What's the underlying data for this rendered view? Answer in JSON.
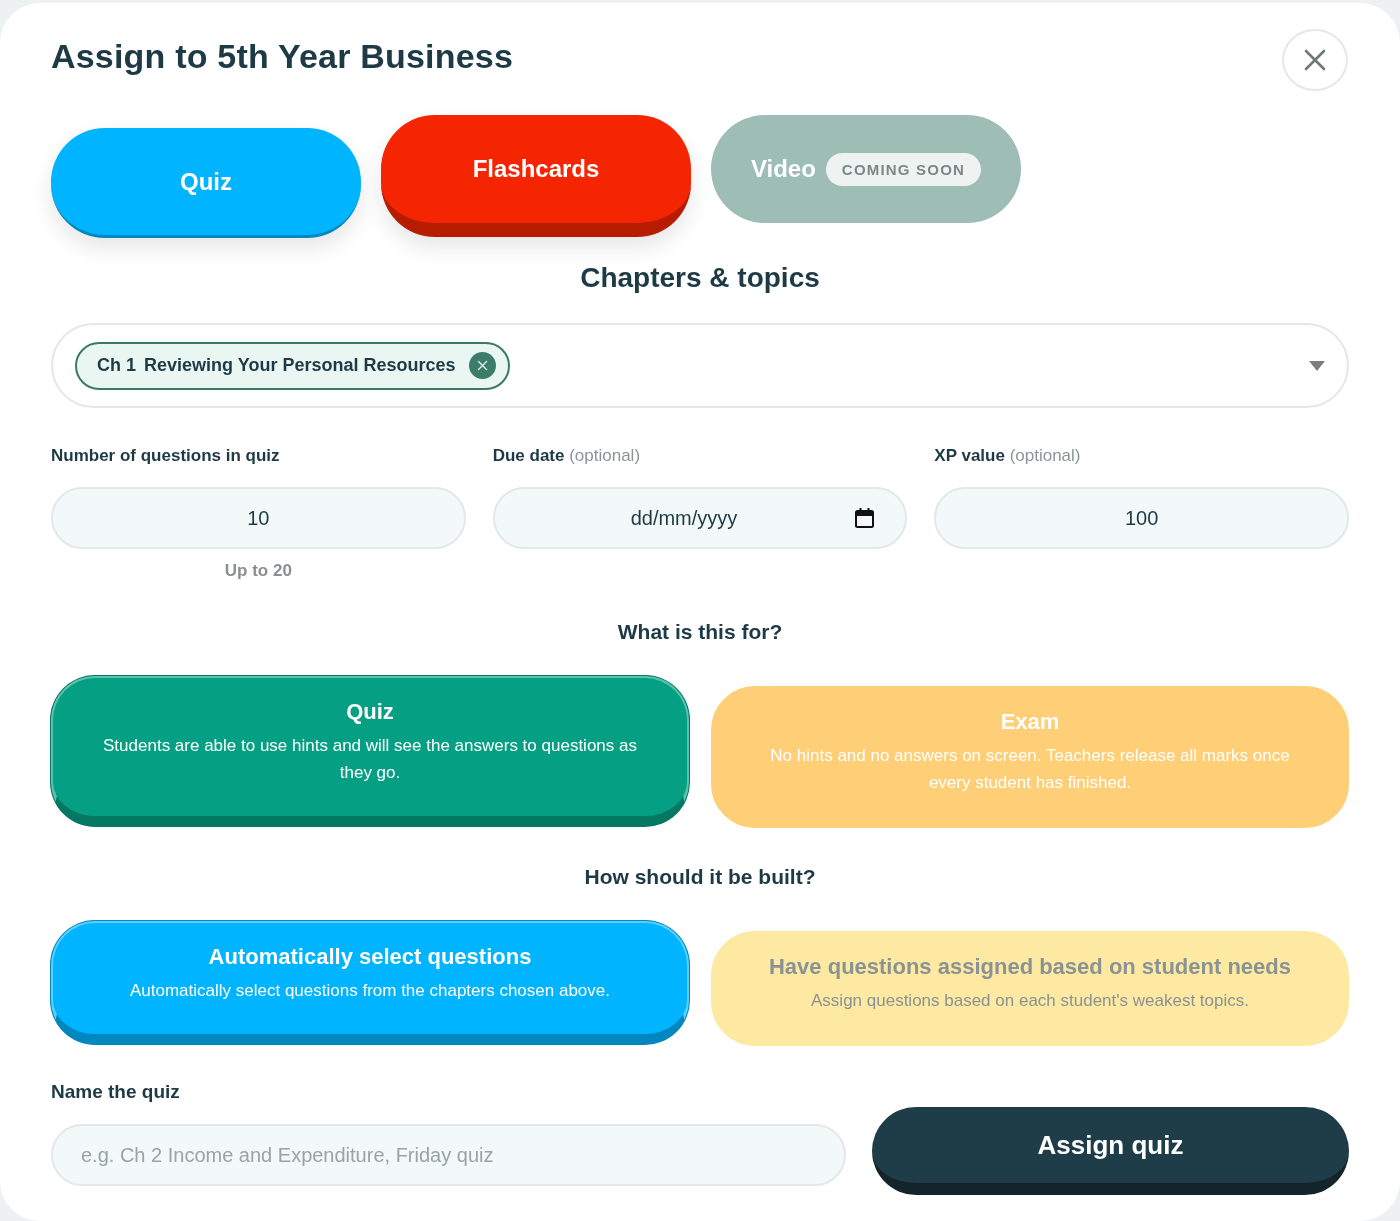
{
  "dialog": {
    "title": "Assign to 5th Year Business"
  },
  "tabs": [
    {
      "label": "Quiz",
      "selected": true,
      "disabled": false,
      "color": "#00b4ff"
    },
    {
      "label": "Flashcards",
      "selected": false,
      "disabled": false,
      "color": "#f42500"
    },
    {
      "label": "Video",
      "badge": "COMING SOON",
      "selected": false,
      "disabled": true,
      "color": "#9ebdb5"
    }
  ],
  "chapters": {
    "heading": "Chapters & topics",
    "chips": [
      {
        "number": "Ch 1",
        "title": "Reviewing Your Personal Resources"
      }
    ]
  },
  "fields": [
    {
      "kind": "number",
      "label": "Number of questions in quiz",
      "value": "10",
      "hint": "Up to 20"
    },
    {
      "kind": "date",
      "label": "Due date",
      "optional": "(optional)",
      "placeholder": "dd/mm/yyyy"
    },
    {
      "kind": "number",
      "label": "XP value",
      "optional": "(optional)",
      "value": "100"
    }
  ],
  "purpose": {
    "heading": "What is this for?",
    "options": [
      {
        "title": "Quiz",
        "description": "Students are able to use hints and will see the answers to questions as they go.",
        "selected": true,
        "disabled": false,
        "color": "#05a083"
      },
      {
        "title": "Exam",
        "description": "No hints and no answers on screen. Teachers release all marks once every student has finished.",
        "selected": false,
        "disabled": false,
        "color": "#fecf77"
      }
    ]
  },
  "build": {
    "heading": "How should it be built?",
    "options": [
      {
        "title": "Automatically select questions",
        "description": "Automatically select questions from the chapters chosen above.",
        "selected": true,
        "disabled": false,
        "color": "#00b4ff"
      },
      {
        "title": "Have questions assigned based on student needs",
        "description": "Assign questions based on each student's weakest topics.",
        "selected": false,
        "disabled": true,
        "color": "#fde9a2"
      }
    ]
  },
  "quiz_name": {
    "label": "Name the quiz",
    "placeholder": "e.g. Ch 2 Income and Expenditure, Friday quiz"
  },
  "submit": {
    "label": "Assign quiz"
  }
}
